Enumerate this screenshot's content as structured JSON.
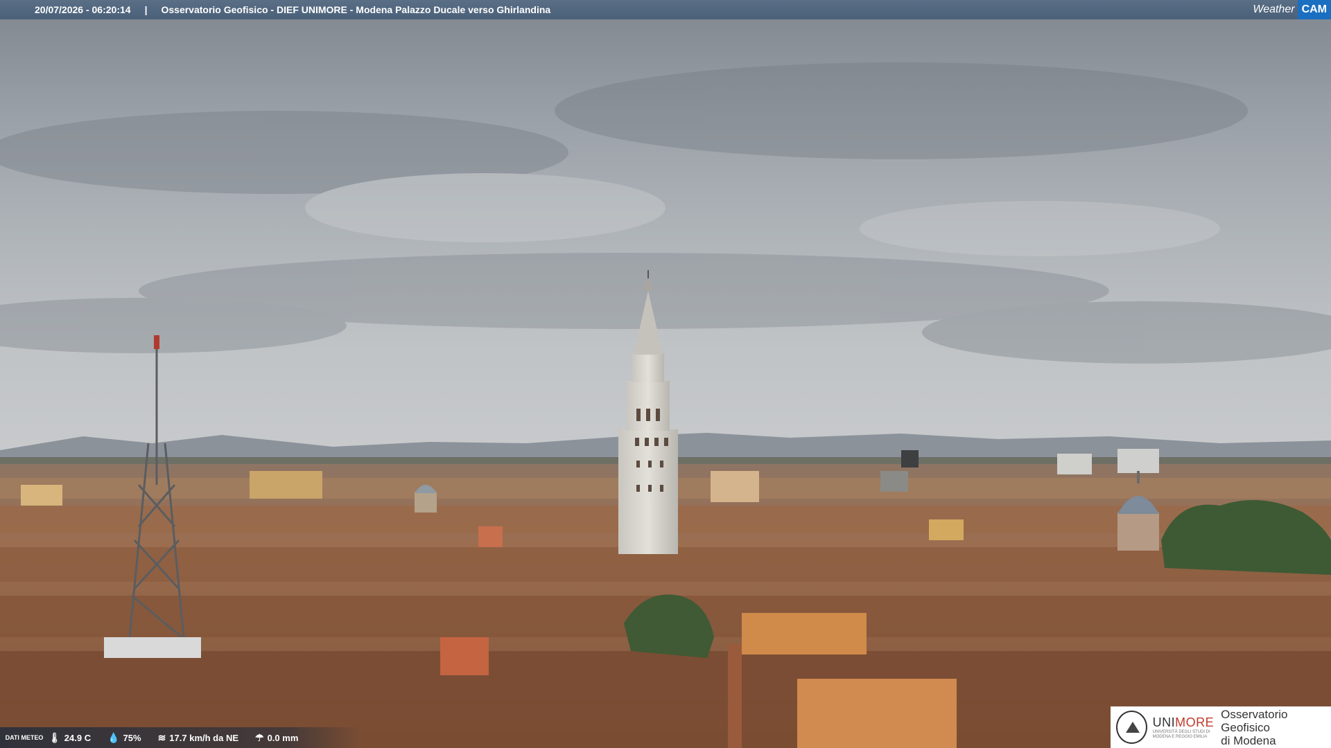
{
  "header": {
    "timestamp": "20/07/2026 - 06:20:14",
    "separator": "|",
    "title": "Osservatorio Geofisico - DIEF UNIMORE - Modena Palazzo Ducale verso Ghirlandina",
    "logo_word": "Weather",
    "logo_cam": "CAM"
  },
  "weather": {
    "label": "DATI METEO",
    "temperature": "24.9 C",
    "humidity": "75%",
    "wind": "17.7 km/h da NE",
    "rain": "0.0 mm",
    "icons": [
      "thermometer-icon",
      "humidity-icon",
      "wind-icon",
      "rain-icon"
    ]
  },
  "footer_logo": {
    "brand_uni": "UNI",
    "brand_more": "MORE",
    "brand_sub1": "UNIVERSITÀ DEGLI STUDI DI",
    "brand_sub2": "MODENA E REGGIO EMILIA",
    "observatory_line1": "Osservatorio Geofisico",
    "observatory_line2": "di Modena"
  },
  "colors": {
    "topbar": "#4f6780",
    "brand_blue": "#1b6fc0",
    "brand_red": "#c0392b"
  }
}
